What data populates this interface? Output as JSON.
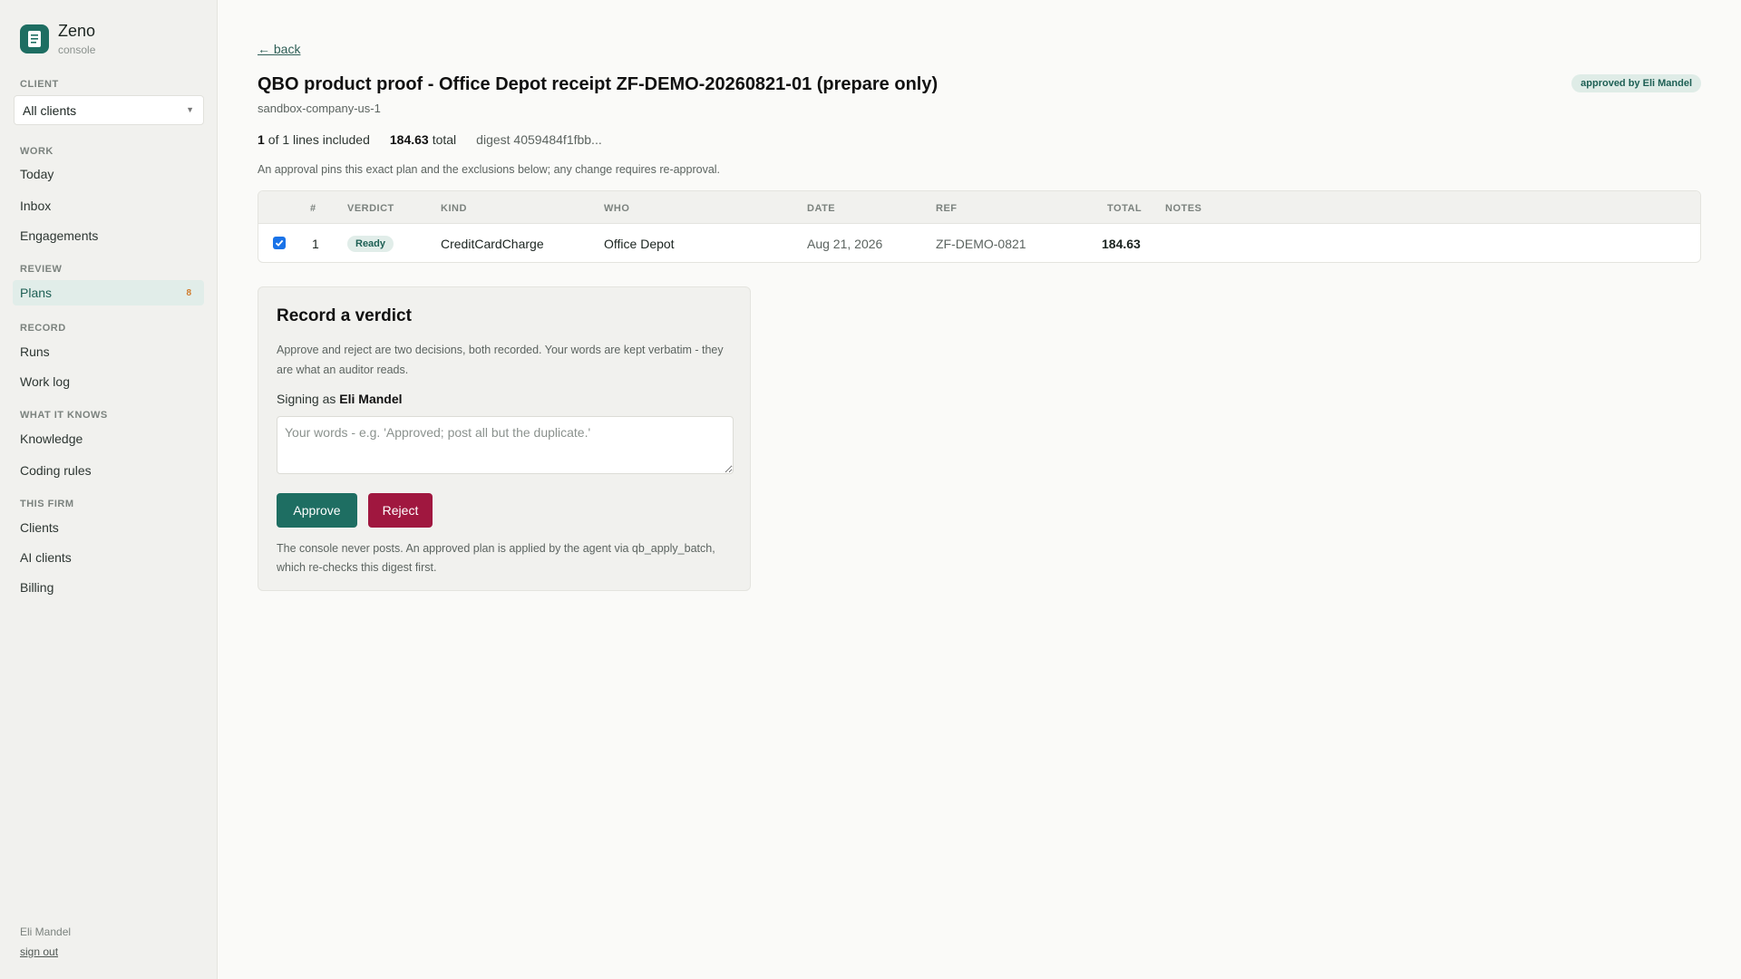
{
  "app": {
    "name": "Zeno",
    "subtitle": "console"
  },
  "sidebar": {
    "client_label": "CLIENT",
    "client_select": {
      "value": "All clients"
    },
    "sections": [
      {
        "label": "WORK",
        "items": [
          {
            "label": "Today"
          },
          {
            "label": "Inbox"
          },
          {
            "label": "Engagements"
          }
        ]
      },
      {
        "label": "REVIEW",
        "items": [
          {
            "label": "Plans",
            "badge": "8",
            "active": true
          }
        ]
      },
      {
        "label": "RECORD",
        "items": [
          {
            "label": "Runs"
          },
          {
            "label": "Work log"
          }
        ]
      },
      {
        "label": "WHAT IT KNOWS",
        "items": [
          {
            "label": "Knowledge"
          },
          {
            "label": "Coding rules"
          }
        ]
      },
      {
        "label": "THIS FIRM",
        "items": [
          {
            "label": "Clients"
          },
          {
            "label": "AI clients"
          },
          {
            "label": "Billing"
          }
        ]
      }
    ],
    "user": "Eli Mandel",
    "sign_out": "sign out"
  },
  "page": {
    "back": "← back",
    "title": "QBO product proof - Office Depot receipt ZF-DEMO-20260821-01 (prepare only)",
    "approved_badge": "approved by Eli Mandel",
    "company": "sandbox-company-us-1",
    "summary": {
      "included_count": "1",
      "included_rest": "of 1 lines included",
      "total_value": "184.63",
      "total_label": "total",
      "digest": "digest 4059484f1fbb..."
    },
    "approval_note": "An approval pins this exact plan and the exclusions below; any change requires re-approval."
  },
  "table": {
    "headers": {
      "num": "#",
      "verdict": "VERDICT",
      "kind": "KIND",
      "who": "WHO",
      "date": "DATE",
      "ref": "REF",
      "total": "TOTAL",
      "notes": "NOTES"
    },
    "rows": [
      {
        "checked": true,
        "num": "1",
        "verdict": "Ready",
        "kind": "CreditCardCharge",
        "who": "Office Depot",
        "date": "Aug 21, 2026",
        "ref": "ZF-DEMO-0821",
        "total": "184.63",
        "notes": ""
      }
    ]
  },
  "verdict": {
    "title": "Record a verdict",
    "description": "Approve and reject are two decisions, both recorded. Your words are kept verbatim - they are what an auditor reads.",
    "signing_prefix": "Signing as",
    "signing_name": "Eli Mandel",
    "words_placeholder": "Your words - e.g. 'Approved; post all but the duplicate.'",
    "words_value": "",
    "approve_label": "Approve",
    "reject_label": "Reject",
    "footer": "The console never posts. An approved plan is applied by the agent via qb_apply_batch, which re-checks this digest first."
  },
  "colors": {
    "brand": "#1e6e62",
    "approve": "#1e6e62",
    "reject": "#a0173f",
    "badge_orange": "#d07a2b",
    "checkbox": "#1a73e8"
  },
  "icons": {
    "brand": "notebook-icon",
    "client_select": "chevron-down-icon",
    "checkbox": "checkmark-icon"
  }
}
